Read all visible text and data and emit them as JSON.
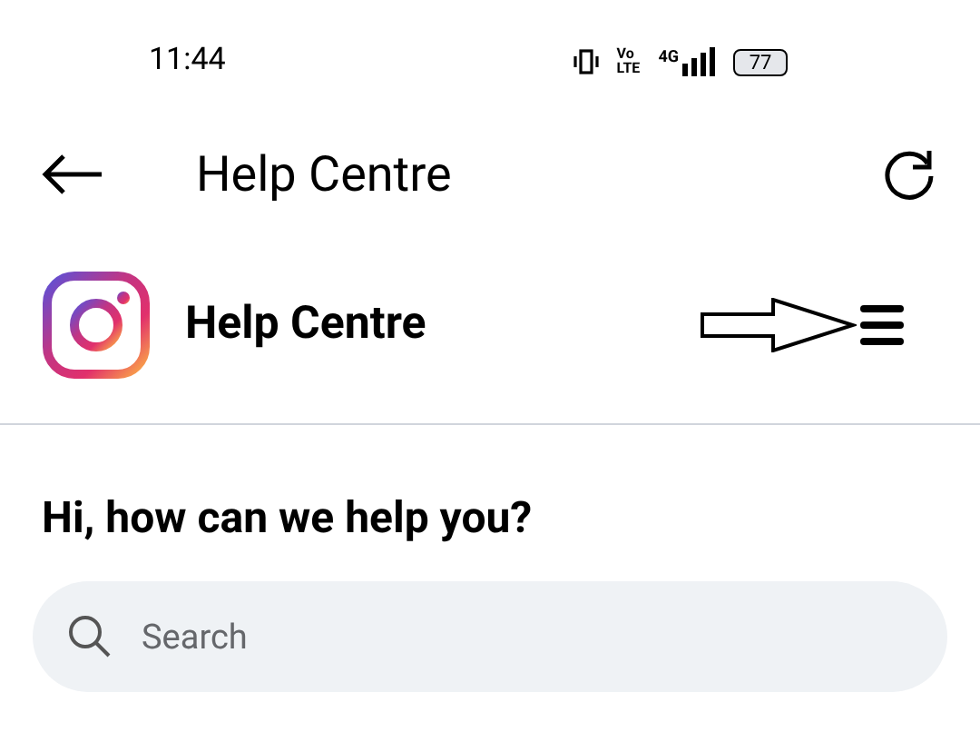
{
  "status_bar": {
    "time": "11:44",
    "network_top": "Vo",
    "network_bottom": "LTE",
    "network_type": "4G",
    "battery": "77"
  },
  "app_bar": {
    "title": "Help Centre"
  },
  "site_header": {
    "title": "Help Centre"
  },
  "heading": "Hi, how can we help you?",
  "search": {
    "placeholder": "Search"
  }
}
